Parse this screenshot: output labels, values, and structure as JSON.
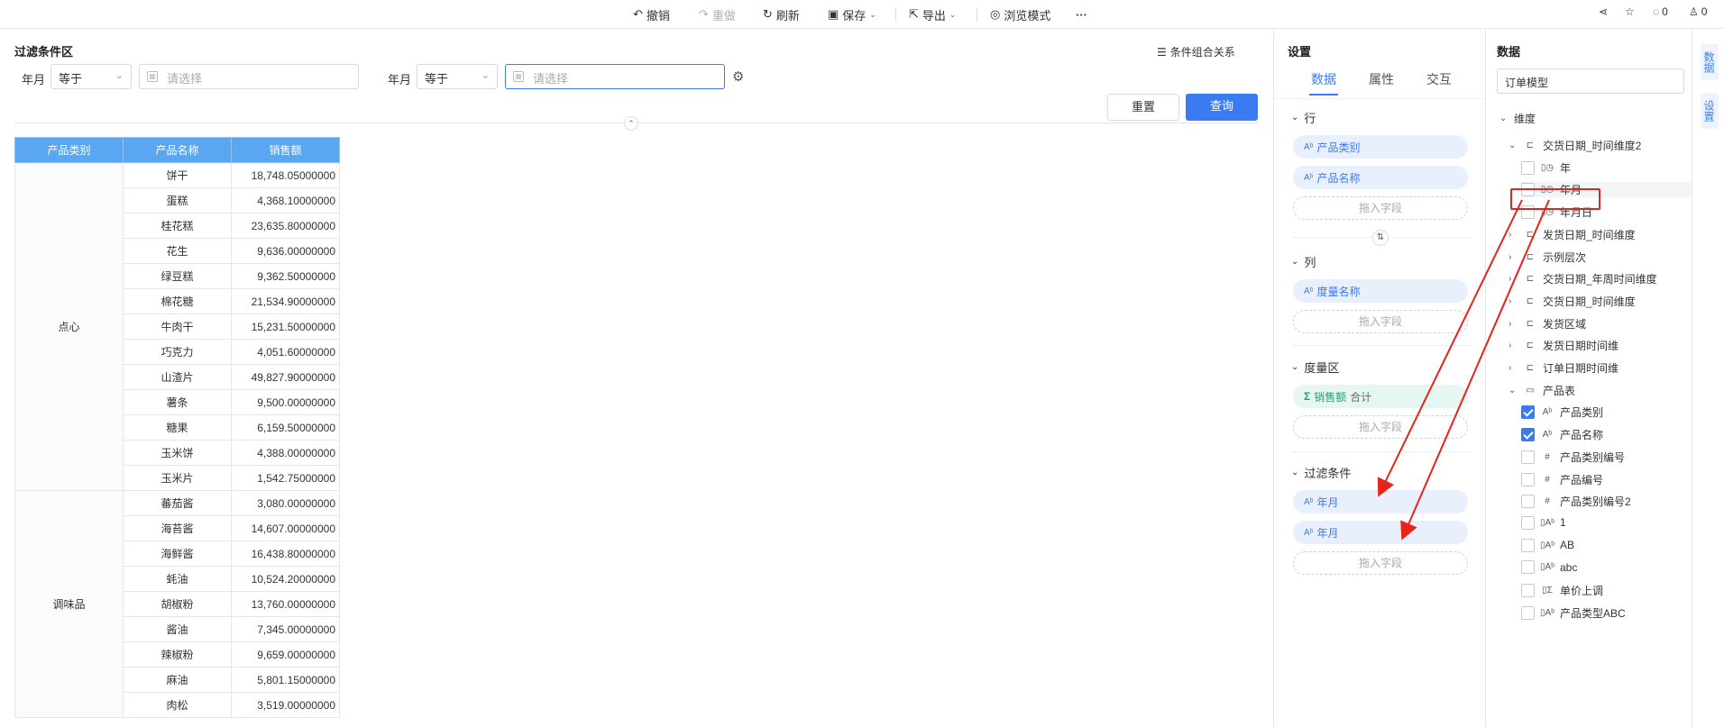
{
  "toolbar": {
    "undo": "撤销",
    "redo": "重做",
    "refresh": "刷新",
    "save": "保存",
    "export": "导出",
    "browse": "浏览模式",
    "more": "···",
    "comments": "0",
    "likes": "0"
  },
  "filter": {
    "title": "过滤条件区",
    "combo": "条件组合关系",
    "field1": "年月",
    "op1": "等于",
    "ph1": "请选择",
    "field2": "年月",
    "op2": "等于",
    "ph2": "请选择",
    "reset": "重置",
    "query": "查询"
  },
  "table": {
    "headers": [
      "产品类别",
      "产品名称",
      "销售额"
    ],
    "groups": [
      {
        "category": "点心",
        "rows": [
          [
            "饼干",
            "18,748.05000000"
          ],
          [
            "蛋糕",
            "4,368.10000000"
          ],
          [
            "桂花糕",
            "23,635.80000000"
          ],
          [
            "花生",
            "9,636.00000000"
          ],
          [
            "绿豆糕",
            "9,362.50000000"
          ],
          [
            "棉花糖",
            "21,534.90000000"
          ],
          [
            "牛肉干",
            "15,231.50000000"
          ],
          [
            "巧克力",
            "4,051.60000000"
          ],
          [
            "山渣片",
            "49,827.90000000"
          ],
          [
            "薯条",
            "9,500.00000000"
          ],
          [
            "糖果",
            "6,159.50000000"
          ],
          [
            "玉米饼",
            "4,388.00000000"
          ],
          [
            "玉米片",
            "1,542.75000000"
          ]
        ]
      },
      {
        "category": "调味品",
        "rows": [
          [
            "蕃茄酱",
            "3,080.00000000"
          ],
          [
            "海苔酱",
            "14,607.00000000"
          ],
          [
            "海鲜酱",
            "16,438.80000000"
          ],
          [
            "蚝油",
            "10,524.20000000"
          ],
          [
            "胡椒粉",
            "13,760.00000000"
          ],
          [
            "酱油",
            "7,345.00000000"
          ],
          [
            "辣椒粉",
            "9,659.00000000"
          ],
          [
            "麻油",
            "5,801.15000000"
          ],
          [
            "肉松",
            "3,519.00000000"
          ]
        ]
      }
    ]
  },
  "settings": {
    "title": "设置",
    "tabs": [
      "数据",
      "属性",
      "交互"
    ],
    "rows_label": "行",
    "row_fields": [
      "产品类别",
      "产品名称"
    ],
    "cols_label": "列",
    "col_fields": [
      "度量名称"
    ],
    "measure_label": "度量区",
    "measure_name": "销售额",
    "measure_agg": "合计",
    "filter_label": "过滤条件",
    "filter_fields": [
      "年月",
      "年月"
    ],
    "drop_hint": "拖入字段"
  },
  "data_panel": {
    "title": "数据",
    "model": "订单模型",
    "dim_label": "维度",
    "nodes": [
      {
        "label": "交货日期_时间维度2",
        "kind": "tree",
        "level": 1,
        "arrow": "v"
      },
      {
        "label": "年",
        "kind": "date",
        "level": 2,
        "checked": false
      },
      {
        "label": "年月",
        "kind": "date",
        "level": 2,
        "checked": false,
        "highlight": true
      },
      {
        "label": "年月日",
        "kind": "date",
        "level": 2,
        "checked": false
      },
      {
        "label": "发货日期_时间维度",
        "kind": "tree",
        "level": 1,
        "arrow": ">"
      },
      {
        "label": "示例层次",
        "kind": "tree",
        "level": 1,
        "arrow": ">"
      },
      {
        "label": "交货日期_年周时间维度",
        "kind": "tree",
        "level": 1,
        "arrow": ">"
      },
      {
        "label": "交货日期_时间维度",
        "kind": "tree",
        "level": 1,
        "arrow": ">"
      },
      {
        "label": "发货区域",
        "kind": "tree",
        "level": 1,
        "arrow": ">"
      },
      {
        "label": "发货日期时间维",
        "kind": "tree",
        "level": 1,
        "arrow": ">"
      },
      {
        "label": "订单日期时间维",
        "kind": "tree",
        "level": 1,
        "arrow": ">"
      },
      {
        "label": "产品表",
        "kind": "table",
        "level": 1,
        "arrow": "v"
      },
      {
        "label": "产品类别",
        "kind": "text",
        "level": 2,
        "checked": true
      },
      {
        "label": "产品名称",
        "kind": "text",
        "level": 2,
        "checked": true
      },
      {
        "label": "产品类别编号",
        "kind": "num",
        "level": 2,
        "checked": false
      },
      {
        "label": "产品编号",
        "kind": "num",
        "level": 2,
        "checked": false
      },
      {
        "label": "产品类别编号2",
        "kind": "num",
        "level": 2,
        "checked": false
      },
      {
        "label": "1",
        "kind": "calc",
        "level": 2,
        "checked": false
      },
      {
        "label": "AB",
        "kind": "calc",
        "level": 2,
        "checked": false
      },
      {
        "label": "abc",
        "kind": "calc",
        "level": 2,
        "checked": false
      },
      {
        "label": "单价上调",
        "kind": "sum",
        "level": 2,
        "checked": false
      },
      {
        "label": "产品类型ABC",
        "kind": "calc",
        "level": 2,
        "checked": false
      }
    ]
  },
  "side_tabs": [
    "数据",
    "设置"
  ],
  "colors": {
    "accent": "#3a7bf2",
    "header": "#5ba6f0",
    "arrow": "#e8231a"
  }
}
